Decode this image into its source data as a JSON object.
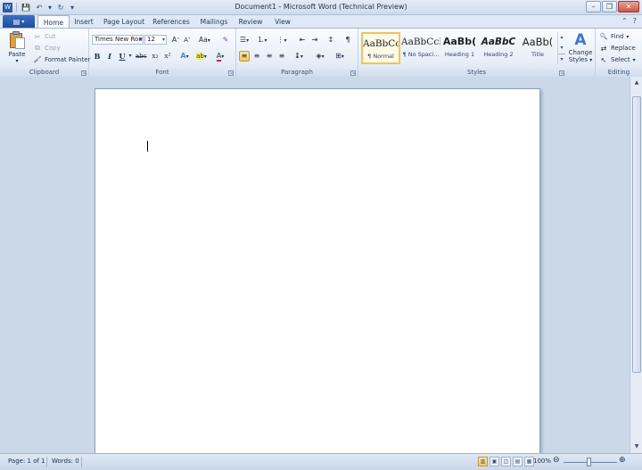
{
  "window": {
    "title": "Document1 - Microsoft Word (Technical Preview)",
    "minimize_glyph": "–",
    "restore_glyph": "❐",
    "close_glyph": "✕"
  },
  "qat": {
    "save_glyph": "💾",
    "undo_glyph": "↶",
    "dropdown_glyph": "▾",
    "redo_glyph": "↻",
    "customize_glyph": "▾"
  },
  "tabs": {
    "file_glyph": "▤",
    "file_arrow": "▾",
    "items": [
      "Home",
      "Insert",
      "Page Layout",
      "References",
      "Mailings",
      "Review",
      "View"
    ]
  },
  "help_controls": {
    "minimize_ribbon_glyph": "⌃",
    "help_glyph": "?"
  },
  "clipboard": {
    "label": "Clipboard",
    "paste_label": "Paste",
    "paste_arrow": "▾",
    "cut_label": "Cut",
    "cut_glyph": "✂",
    "copy_label": "Copy",
    "copy_glyph": "⧉",
    "format_painter_label": "Format Painter",
    "format_painter_glyph": "🖌",
    "launcher": "↘"
  },
  "font": {
    "label": "Font",
    "name": "Times New Rom",
    "size": "12",
    "combo_arrow": "▾",
    "grow": "A",
    "grow_sup": "˄",
    "shrink": "A",
    "shrink_sup": "˅",
    "change_case": "Aa",
    "clear_format_glyph": "✎",
    "bold": "B",
    "italic": "I",
    "underline": "U",
    "strike": "abc",
    "subscript": "x₂",
    "superscript": "x²",
    "text_effects": "A",
    "highlight_glyph": "ab",
    "font_color": "A",
    "dropdown": "▾",
    "launcher": "↘"
  },
  "paragraph": {
    "label": "Paragraph",
    "bullets": "☰",
    "numbering": "⒈",
    "multilevel": "⋮",
    "decrease_indent": "⇤",
    "increase_indent": "⇥",
    "sort": "↕",
    "show_marks": "¶",
    "align_left": "≡",
    "center": "≡",
    "align_right": "≡",
    "justify": "≡",
    "line_spacing": "↨",
    "shading": "◈",
    "borders": "⊞",
    "dropdown": "▾",
    "launcher": "↘"
  },
  "styles": {
    "label": "Styles",
    "items": [
      {
        "sample": "AaBbCcI",
        "name": "¶ Normal"
      },
      {
        "sample": "AaBbCcI",
        "name": "¶ No Spaci..."
      },
      {
        "sample": "AaBb(",
        "name": "Heading 1"
      },
      {
        "sample": "AaBbC",
        "name": "Heading 2"
      },
      {
        "sample": "AaBb(",
        "name": "Title"
      }
    ],
    "scroll_up": "▴",
    "scroll_down": "▾",
    "more": "▾",
    "change_styles_label_1": "Change",
    "change_styles_label_2": "Styles",
    "change_styles_arrow": "▾",
    "change_styles_glyph": "A",
    "launcher": "↘"
  },
  "editing": {
    "label": "Editing",
    "find_label": "Find",
    "find_glyph": "🔍",
    "replace_label": "Replace",
    "replace_glyph": "⇄",
    "select_label": "Select",
    "select_glyph": "↖",
    "dropdown": "▾"
  },
  "scrollbar": {
    "up_glyph": "▲",
    "down_glyph": "▼"
  },
  "status": {
    "page": "Page: 1 of 1",
    "words": "Words: 0",
    "zoom": "100%",
    "zoom_out": "⊖",
    "zoom_in": "⊕",
    "view_glyphs": [
      "▥",
      "▣",
      "◫",
      "▤",
      "▦"
    ]
  }
}
